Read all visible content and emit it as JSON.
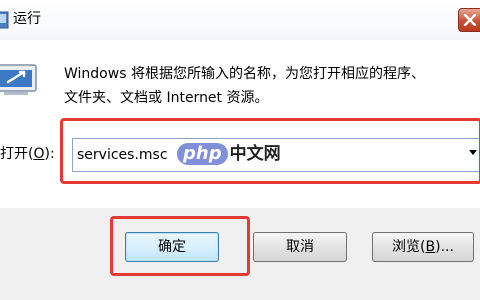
{
  "window": {
    "title": "运行"
  },
  "dialog": {
    "description_line1": "Windows 将根据您所输入的名称，为您打开相应的程序、",
    "description_line2": "文件夹、文档或 Internet 资源。",
    "open_label": "打开(",
    "open_label_key": "O",
    "open_label_end": "):",
    "open_value": "services.msc"
  },
  "watermark": {
    "php": "php",
    "cn": "中文网"
  },
  "buttons": {
    "ok_label": "确定",
    "cancel_label": "取消",
    "browse_label": "浏览(",
    "browse_key": "B",
    "browse_end": ")..."
  },
  "icons": {
    "title": "run-icon",
    "close": "close-icon",
    "dropdown": "chevron-down-icon"
  },
  "colors": {
    "highlight": "#e53935",
    "close_button": "#c45237"
  }
}
